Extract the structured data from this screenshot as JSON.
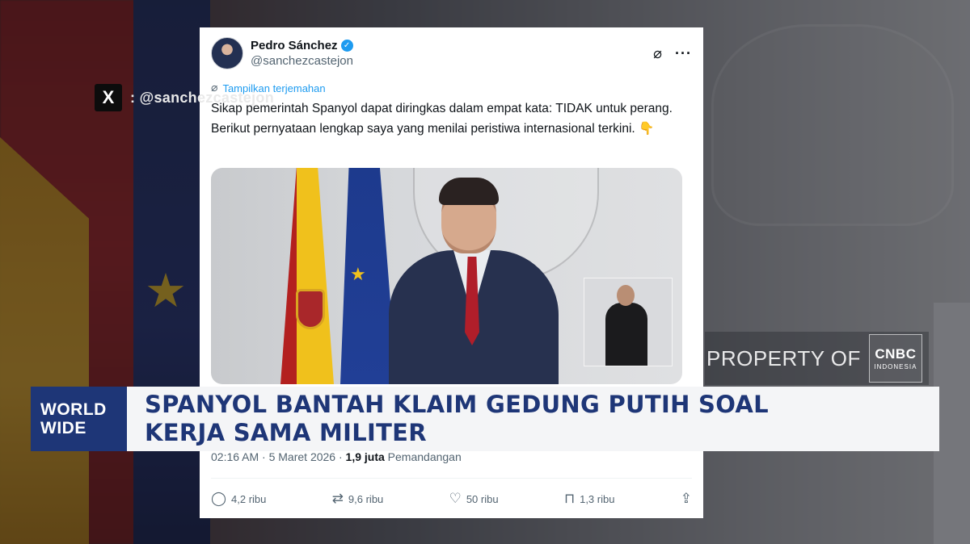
{
  "x_overlay": {
    "logo": "X",
    "handle": ": @sanchezcastejon"
  },
  "tweet": {
    "display_name": "Pedro Sánchez",
    "username": "@sanchezcastejon",
    "verified_icon": "verified-badge-icon",
    "grok_icon": "⌀",
    "more_icon": "···",
    "translate_label": "Tampilkan terjemahan",
    "text": "Sikap pemerintah Spanyol dapat diringkas dalam empat kata: TIDAK untuk perang. Berikut pernyataan lengkap saya yang menilai peristiwa internasional terkini.",
    "emoji": "👇",
    "meta_time": "02:16 AM · 5 Maret 2026 · ",
    "meta_views_count": "1,9 juta",
    "meta_views_label": " Pemandangan",
    "actions": {
      "replies": "4,2 ribu",
      "reposts": "9,6 ribu",
      "likes": "50 ribu",
      "bookmarks": "1,3 ribu"
    }
  },
  "watermark": {
    "text": "PROPERTY OF",
    "logo_main": "CNBC",
    "logo_sub": "INDONESIA"
  },
  "lower_third": {
    "segment_line1": "WORLD",
    "segment_line2": "WIDE",
    "headline_line1": "SPANYOL BANTAH KLAIM GEDUNG PUTIH SOAL",
    "headline_line2": "KERJA SAMA MILITER"
  },
  "colors": {
    "accent_navy": "#1e3677",
    "link_blue": "#1d9bf0",
    "verified_blue": "#1d9bf0"
  }
}
